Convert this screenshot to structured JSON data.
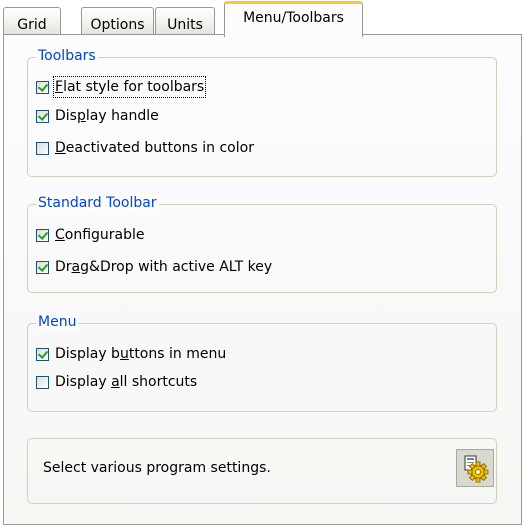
{
  "tabs": [
    {
      "label": "Grid"
    },
    {
      "label": "Options"
    },
    {
      "label": "Units"
    },
    {
      "label": "Menu/Toolbars",
      "active": true
    }
  ],
  "toolbars": {
    "title": "Toolbars",
    "flat_style": {
      "pre": "",
      "key": "F",
      "post": "lat style for toolbars",
      "checked": true
    },
    "display_handle": {
      "pre": "Dis",
      "key": "p",
      "post": "lay handle",
      "checked": true
    },
    "deactivated": {
      "pre": "",
      "key": "D",
      "post": "eactivated buttons in color",
      "checked": false
    }
  },
  "standard_toolbar": {
    "title": "Standard Toolbar",
    "configurable": {
      "pre": "",
      "key": "C",
      "post": "onfigurable",
      "checked": true
    },
    "dragdrop": {
      "pre": "Dr",
      "key": "a",
      "post": "g&Drop with active ALT key",
      "checked": true
    }
  },
  "menu": {
    "title": "Menu",
    "display_buttons": {
      "pre": "Display b",
      "key": "u",
      "post": "ttons in menu",
      "checked": true
    },
    "display_shortcuts": {
      "pre": "Display ",
      "key": "a",
      "post": "ll shortcuts",
      "checked": false
    }
  },
  "info": {
    "text": "Select various program settings.",
    "icon": "settings-gear-icon"
  },
  "colors": {
    "group_title": "#0046d5",
    "check": "#21a121",
    "active_tab_accent": "#ffc83c"
  }
}
